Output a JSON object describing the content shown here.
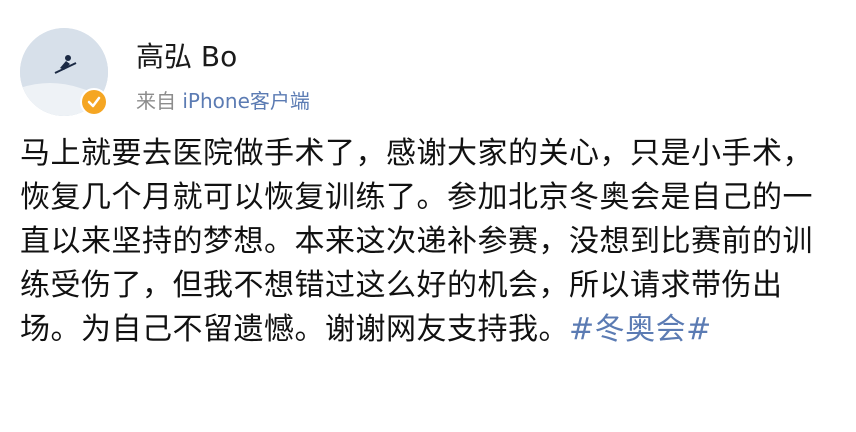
{
  "post": {
    "username": "高弘 Bo",
    "source_prefix": "来自 ",
    "source_client": "iPhone客户端",
    "content_text": "马上就要去医院做手术了，感谢大家的关心，只是小手术，恢复几个月就可以恢复训练了。参加北京冬奥会是自己的一直以来坚持的梦想。本来这次递补参赛，没想到比赛前的训练受伤了，但我不想错过这么好的机会，所以请求带伤出场。为自己不留遗憾。谢谢网友支持我。",
    "hashtag": "#冬奥会#"
  },
  "icons": {
    "avatar": "avatar-image",
    "badge": "verified-badge-icon"
  },
  "colors": {
    "link": "#5b7bb3",
    "text": "#111111",
    "meta": "#8c8c8c",
    "badge": "#f5a623"
  }
}
